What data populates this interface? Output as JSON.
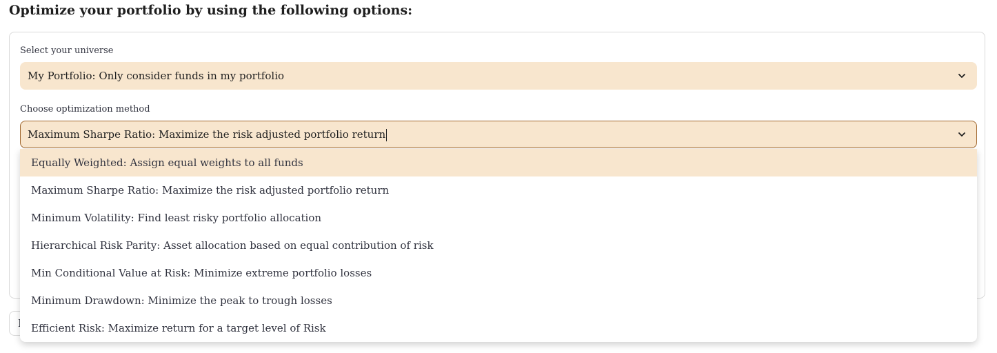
{
  "heading": "Optimize your portfolio by using the following options:",
  "universe": {
    "label": "Select your universe",
    "selected": "My Portfolio: Only consider funds in my portfolio"
  },
  "method": {
    "label": "Choose optimization method",
    "selected": "Maximum Sharpe Ratio: Maximize the risk adjusted portfolio return",
    "options": [
      "Equally Weighted: Assign equal weights to all funds",
      "Maximum Sharpe Ratio: Maximize the risk adjusted portfolio return",
      "Minimum Volatility: Find least risky portfolio allocation",
      "Hierarchical Risk Parity: Asset allocation based on equal contribution of risk",
      "Min Conditional Value at Risk: Minimize extreme portfolio losses",
      "Minimum Drawdown: Minimize the peak to trough losses",
      "Efficient Risk: Maximize return for a target level of Risk"
    ]
  },
  "icons": {
    "universe_chevron": "chevron-down-icon",
    "method_chevron": "chevron-down-icon"
  },
  "colors": {
    "select_bg": "#f8e6ce",
    "focus_border": "#a0672e",
    "text": "#31333f"
  },
  "underlay": {
    "partial_text": "I"
  }
}
